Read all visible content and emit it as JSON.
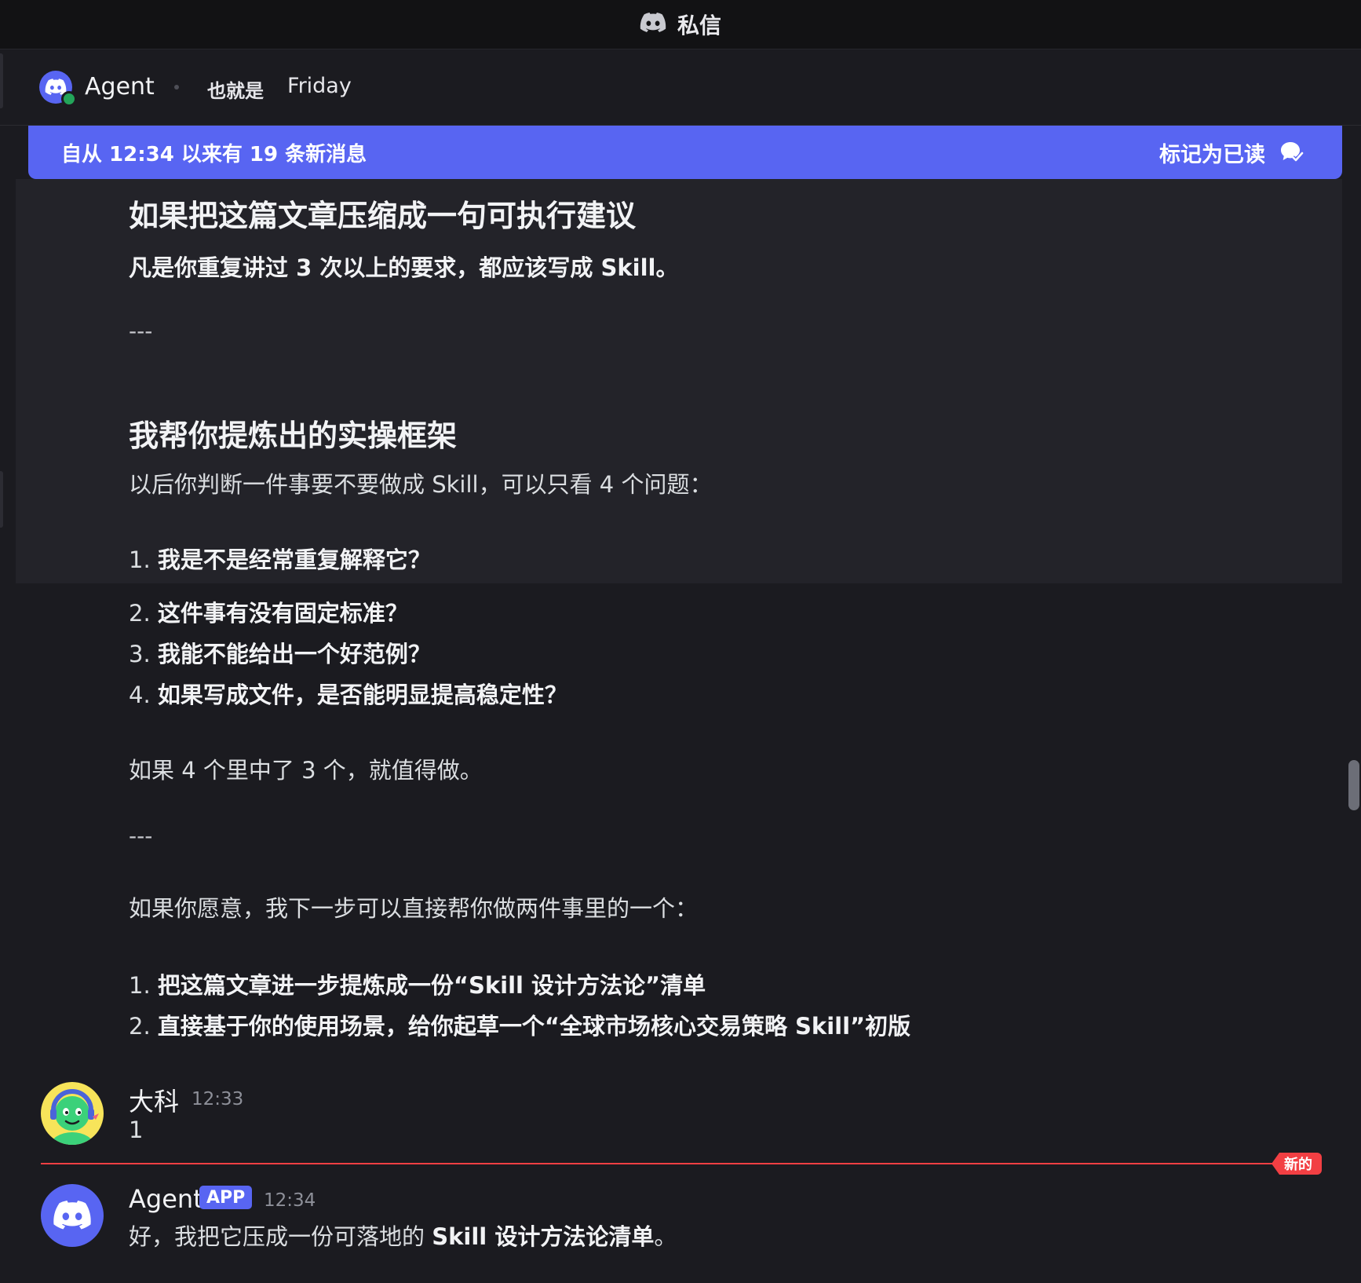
{
  "window": {
    "title": "私信"
  },
  "header": {
    "name": "Agent",
    "aka_label": "也就是",
    "alias": "Friday"
  },
  "banner": {
    "text": "自从 12:34 以来有 19 条新消息",
    "action": "标记为已读"
  },
  "message_body": {
    "heading1": "如果把这篇文章压缩成一句可执行建议",
    "summary": "凡是你重复讲过 3 次以上的要求，都应该写成 Skill。",
    "sep1": "---",
    "heading2": "我帮你提炼出的实操框架",
    "intro": "以后你判断一件事要不要做成 Skill，可以只看 4 个问题：",
    "questions": [
      {
        "num": "1.",
        "text": "我是不是经常重复解释它？"
      },
      {
        "num": "2.",
        "text": "这件事有没有固定标准？"
      },
      {
        "num": "3.",
        "text": "我能不能给出一个好范例？"
      },
      {
        "num": "4.",
        "text": "如果写成文件，是否能明显提高稳定性？"
      }
    ],
    "conclusion": "如果 4 个里中了 3 个，就值得做。",
    "sep2": "---",
    "offer": "如果你愿意，我下一步可以直接帮你做两件事里的一个：",
    "options": [
      {
        "num": "1.",
        "text": "把这篇文章进一步提炼成一份“Skill 设计方法论”清单"
      },
      {
        "num": "2.",
        "text": "直接基于你的使用场景，给你起草一个“全球市场核心交易策略 Skill”初版"
      }
    ]
  },
  "messages": [
    {
      "author": "大科",
      "time": "12:33",
      "text": "1"
    },
    {
      "author": "Agent",
      "badge": "APP",
      "time": "12:34",
      "text_pre": "好，我把它压成一份可落地的 ",
      "text_bold": "Skill 设计方法论清单",
      "text_post": "。"
    }
  ],
  "divider": {
    "label": "新的"
  },
  "colors": {
    "accent": "#5865f2",
    "new_red": "#f23f43",
    "online": "#23a55a",
    "background": "#1b1b20"
  }
}
